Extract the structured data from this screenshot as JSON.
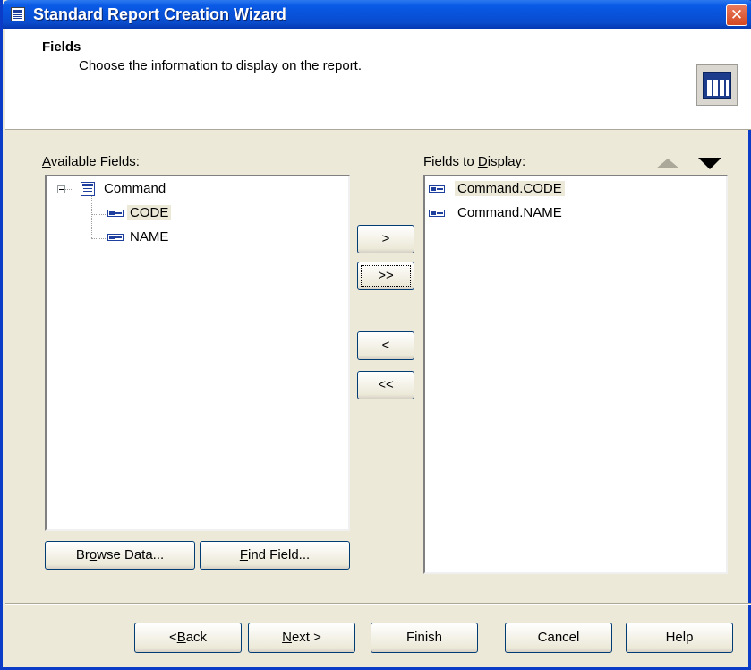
{
  "window": {
    "title": "Standard Report Creation Wizard"
  },
  "header": {
    "title": "Fields",
    "subtitle": "Choose the information to display on the report."
  },
  "available": {
    "label_accel": "A",
    "label_rest": "vailable Fields:",
    "root": "Command",
    "items": [
      "CODE",
      "NAME"
    ],
    "selected": "CODE"
  },
  "display": {
    "label_pre": "Fields to ",
    "label_accel": "D",
    "label_rest": "isplay:",
    "items": [
      "Command.CODE",
      "Command.NAME"
    ],
    "selected": "Command.CODE"
  },
  "transfer": {
    "add": ">",
    "add_all": ">>",
    "remove": "<",
    "remove_all": "<<"
  },
  "actions": {
    "browse_pre": "Br",
    "browse_accel": "o",
    "browse_rest": "wse Data...",
    "find_accel": "F",
    "find_rest": "ind Field..."
  },
  "footer": {
    "back_pre": "< ",
    "back_accel": "B",
    "back_rest": "ack",
    "next_accel": "N",
    "next_rest": "ext >",
    "finish": "Finish",
    "cancel": "Cancel",
    "help": "Help"
  }
}
